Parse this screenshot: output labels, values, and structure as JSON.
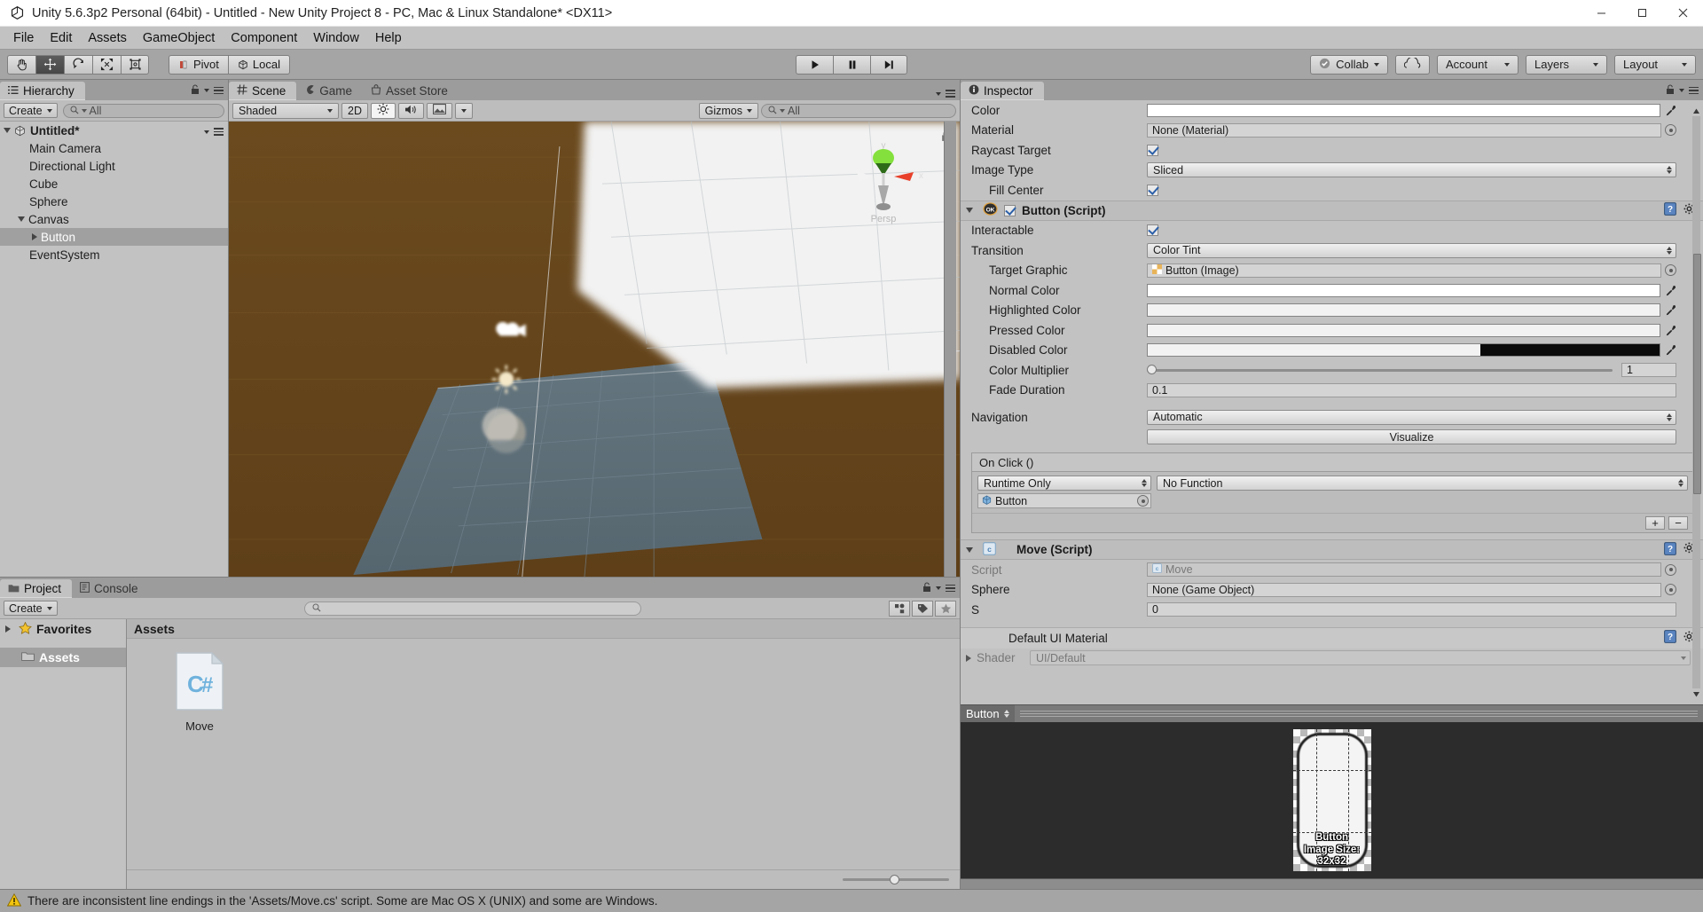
{
  "window": {
    "title": "Unity 5.6.3p2 Personal (64bit) - Untitled - New Unity Project 8 - PC, Mac & Linux Standalone* <DX11>",
    "minimize": "minimize-icon",
    "maximize": "maximize-icon",
    "close": "close-icon"
  },
  "menubar": {
    "items": [
      "File",
      "Edit",
      "Assets",
      "GameObject",
      "Component",
      "Window",
      "Help"
    ]
  },
  "toolbar": {
    "tools": [
      {
        "name": "hand-tool",
        "glyph": "✋",
        "active": false
      },
      {
        "name": "move-tool",
        "glyph": "✥",
        "active": true
      },
      {
        "name": "rotate-tool",
        "glyph": "↻",
        "active": false
      },
      {
        "name": "scale-tool",
        "glyph": "⤢",
        "active": false
      },
      {
        "name": "rect-tool",
        "glyph": "▣",
        "active": false
      }
    ],
    "pivot_label": "Pivot",
    "local_label": "Local",
    "play_label": "▶",
    "pause_label": "❙❙",
    "step_label": "▶❙",
    "collab_label": "Collab",
    "cloud_label": "cloud-icon",
    "account_label": "Account",
    "layers_label": "Layers",
    "layout_label": "Layout"
  },
  "hierarchy": {
    "tab_label": "Hierarchy",
    "create_label": "Create",
    "search_placeholder": "All",
    "scene_name": "Untitled*",
    "items": [
      {
        "label": "Main Camera",
        "indent": 1,
        "expand": "none",
        "selected": false
      },
      {
        "label": "Directional Light",
        "indent": 1,
        "expand": "none",
        "selected": false
      },
      {
        "label": "Cube",
        "indent": 1,
        "expand": "none",
        "selected": false
      },
      {
        "label": "Sphere",
        "indent": 1,
        "expand": "none",
        "selected": false
      },
      {
        "label": "Canvas",
        "indent": 1,
        "expand": "down",
        "selected": false
      },
      {
        "label": "Button",
        "indent": 2,
        "expand": "right",
        "selected": true
      },
      {
        "label": "EventSystem",
        "indent": 1,
        "expand": "none",
        "selected": false
      }
    ]
  },
  "scene": {
    "tabs": [
      {
        "label": "Scene",
        "icon": "grid-icon",
        "active": true
      },
      {
        "label": "Game",
        "icon": "gamepad-icon",
        "active": false
      },
      {
        "label": "Asset Store",
        "icon": "store-icon",
        "active": false
      }
    ],
    "shading_mode": "Shaded",
    "mode_2d": "2D",
    "lighting_icon": "sun-icon",
    "audio_icon": "speaker-icon",
    "effects_icon": "image-icon",
    "gizmos_label": "Gizmos",
    "gizmos_search_placeholder": "All",
    "axis_gizmo": {
      "y_label": "y",
      "x_label": "x",
      "persp_label": "Persp"
    }
  },
  "project": {
    "tabs": [
      {
        "label": "Project",
        "icon": "folder-icon",
        "active": true
      },
      {
        "label": "Console",
        "icon": "console-icon",
        "active": false
      }
    ],
    "create_label": "Create",
    "search_placeholder": "",
    "tree": [
      {
        "label": "Favorites",
        "icon": "star-icon",
        "selected": false,
        "expand": "right"
      },
      {
        "label": "Assets",
        "icon": "folder-icon",
        "selected": true,
        "expand": "none"
      }
    ],
    "content_header": "Assets",
    "assets": [
      {
        "label": "Move",
        "type": "csharp-script",
        "icon": "C#"
      }
    ]
  },
  "inspector": {
    "tab_label": "Inspector",
    "image_component": {
      "fields": [
        {
          "label": "Color",
          "type": "color",
          "indent": 0,
          "value": "#ffffff"
        },
        {
          "label": "Material",
          "type": "object",
          "indent": 0,
          "value": "None (Material)"
        },
        {
          "label": "Raycast Target",
          "type": "checkbox",
          "indent": 0,
          "checked": true
        },
        {
          "label": "Image Type",
          "type": "dropdown",
          "indent": 0,
          "value": "Sliced"
        },
        {
          "label": "Fill Center",
          "type": "checkbox",
          "indent": 1,
          "checked": true
        }
      ]
    },
    "button_component": {
      "title": "Button (Script)",
      "enabled": true,
      "badge": "OK",
      "fields": [
        {
          "label": "Interactable",
          "type": "checkbox",
          "indent": 0,
          "checked": true
        },
        {
          "label": "Transition",
          "type": "dropdown",
          "indent": 0,
          "value": "Color Tint"
        },
        {
          "label": "Target Graphic",
          "type": "object",
          "indent": 1,
          "value": "Button (Image)"
        },
        {
          "label": "Normal Color",
          "type": "color",
          "indent": 1,
          "value": "#ffffff"
        },
        {
          "label": "Highlighted Color",
          "type": "color-off",
          "indent": 1,
          "value": "#f2f2f2"
        },
        {
          "label": "Pressed Color",
          "type": "color-off",
          "indent": 1,
          "value": "#f2f2f2"
        },
        {
          "label": "Disabled Color",
          "type": "color-half",
          "indent": 1,
          "value": "#c8c8c8"
        },
        {
          "label": "Color Multiplier",
          "type": "slider",
          "indent": 1,
          "value": "1"
        },
        {
          "label": "Fade Duration",
          "type": "text",
          "indent": 1,
          "value": "0.1"
        },
        {
          "label": "Navigation",
          "type": "dropdown",
          "indent": 0,
          "value": "Automatic"
        }
      ],
      "visualize_label": "Visualize",
      "onclick": {
        "title": "On Click ()",
        "mode": "Runtime Only",
        "function": "No Function",
        "object": "Button",
        "add_label": "+",
        "remove_label": "−"
      }
    },
    "move_component": {
      "title": "Move (Script)",
      "fields": [
        {
          "label": "Script",
          "type": "object-disabled",
          "indent": 0,
          "value": "Move"
        },
        {
          "label": "Sphere",
          "type": "object",
          "indent": 0,
          "value": "None (Game Object)"
        },
        {
          "label": "S",
          "type": "text",
          "indent": 0,
          "value": "0"
        }
      ]
    },
    "material_component": {
      "title": "Default UI Material",
      "shader_label": "Shader",
      "shader_value": "UI/Default"
    },
    "preview": {
      "title": "Button",
      "sprite_label": "Button",
      "size_label": "Image Size: 32x32"
    }
  },
  "statusbar": {
    "icon": "warning-icon",
    "message": "There are inconsistent line endings in the 'Assets/Move.cs' script. Some are Mac OS X (UNIX) and some are Windows."
  },
  "colors": {
    "toolbar_bg": "#a5a5a5",
    "panel_bg": "#c2c2c2",
    "selection": "#a0a0a0",
    "ground_plane": "#5d6e78",
    "scene_brown": "#6d4b1f",
    "preview_bg": "#2c2c2c"
  }
}
